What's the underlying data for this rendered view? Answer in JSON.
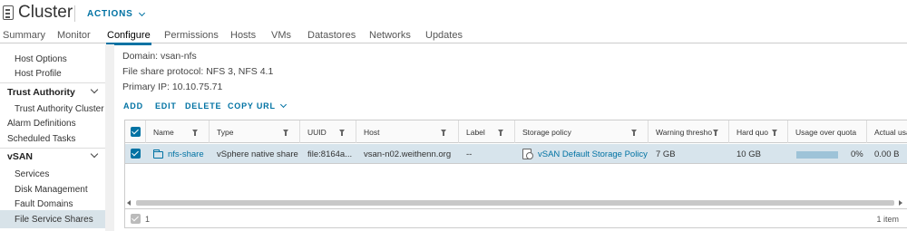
{
  "header": {
    "title": "Cluster",
    "actions_label": "ACTIONS"
  },
  "tabs": [
    {
      "label": "Summary"
    },
    {
      "label": "Monitor"
    },
    {
      "label": "Configure"
    },
    {
      "label": "Permissions"
    },
    {
      "label": "Hosts"
    },
    {
      "label": "VMs"
    },
    {
      "label": "Datastores"
    },
    {
      "label": "Networks"
    },
    {
      "label": "Updates"
    }
  ],
  "active_tab": "Configure",
  "sidebar": {
    "items": {
      "host_options": "Host Options",
      "host_profile": "Host Profile",
      "trust_authority": "Trust Authority",
      "trust_authority_cluster": "Trust Authority Cluster",
      "alarm_definitions": "Alarm Definitions",
      "scheduled_tasks": "Scheduled Tasks",
      "vsan": "vSAN",
      "services": "Services",
      "disk_management": "Disk Management",
      "fault_domains": "Fault Domains",
      "file_service_shares": "File Service Shares"
    },
    "selected": "File Service Shares"
  },
  "info": {
    "domain": "Domain: vsan-nfs",
    "protocol": "File share protocol: NFS 3, NFS 4.1",
    "primary_ip": "Primary IP: 10.10.75.71"
  },
  "toolbar": {
    "add": "ADD",
    "edit": "EDIT",
    "delete": "DELETE",
    "copy_url": "COPY URL"
  },
  "table": {
    "columns": [
      "Name",
      "Type",
      "UUID",
      "Host",
      "Label",
      "Storage policy",
      "Warning thresho",
      "Hard quo",
      "Usage over quota",
      "Actual usa"
    ],
    "rows": [
      {
        "name": "nfs-share",
        "type": "vSphere native share",
        "uuid": "file:8164a...",
        "host": "vsan-n02.weithenn.org",
        "label": "--",
        "storage_policy": "vSAN Default Storage Policy",
        "warning_threshold": "7 GB",
        "hard_quota": "10 GB",
        "usage_over_quota": "0%",
        "usage_fraction": 0,
        "actual_usage": "0.00 B"
      }
    ],
    "selected_count": "1",
    "items_label": "1 item"
  },
  "colors": {
    "accent": "#0072a3",
    "row_selected": "#d7e4ec",
    "usage_bar": "#9ec3d8"
  },
  "icons": {
    "cluster": "cluster-icon",
    "folder": "folder-icon",
    "policy": "storage-policy-icon",
    "filter": "filter-icon"
  }
}
